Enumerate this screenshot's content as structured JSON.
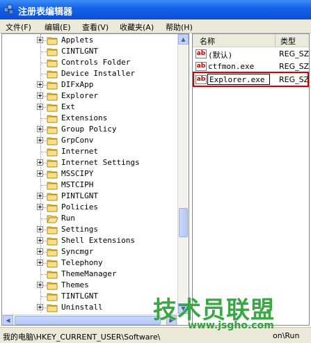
{
  "window": {
    "title": "注册表编辑器"
  },
  "menu": [
    {
      "label": "文件(F)"
    },
    {
      "label": "编辑(E)"
    },
    {
      "label": "查看(V)"
    },
    {
      "label": "收藏夹(A)"
    },
    {
      "label": "帮助(H)"
    }
  ],
  "tree": {
    "items": [
      {
        "label": "Applets",
        "expandable": true
      },
      {
        "label": "CINTLGNT",
        "expandable": false
      },
      {
        "label": "Controls Folder",
        "expandable": false
      },
      {
        "label": "Device Installer",
        "expandable": false
      },
      {
        "label": "DIFxApp",
        "expandable": true
      },
      {
        "label": "Explorer",
        "expandable": true
      },
      {
        "label": "Ext",
        "expandable": true
      },
      {
        "label": "Extensions",
        "expandable": false
      },
      {
        "label": "Group Policy",
        "expandable": true
      },
      {
        "label": "GrpConv",
        "expandable": true
      },
      {
        "label": "Internet",
        "expandable": false
      },
      {
        "label": "Internet Settings",
        "expandable": true
      },
      {
        "label": "MSSCIPY",
        "expandable": true
      },
      {
        "label": "MSTCIPH",
        "expandable": false
      },
      {
        "label": "PINTLGNT",
        "expandable": true
      },
      {
        "label": "Policies",
        "expandable": true
      },
      {
        "label": "Run",
        "expandable": false,
        "open": true
      },
      {
        "label": "Settings",
        "expandable": true
      },
      {
        "label": "Shell Extensions",
        "expandable": true
      },
      {
        "label": "Syncmgr",
        "expandable": true
      },
      {
        "label": "Telephony",
        "expandable": true
      },
      {
        "label": "ThemeManager",
        "expandable": false
      },
      {
        "label": "Themes",
        "expandable": true
      },
      {
        "label": "TINTLGNT",
        "expandable": false
      },
      {
        "label": "Uninstall",
        "expandable": true
      }
    ]
  },
  "list": {
    "headers": {
      "name": "名称",
      "type": "类型"
    },
    "rows": [
      {
        "name": "(默认)",
        "type": "REG_SZ"
      },
      {
        "name": "ctfmon.exe",
        "type": "REG_SZ"
      },
      {
        "name": "Explorer.exe",
        "type": "REG_SZ",
        "editing": true
      }
    ]
  },
  "status": {
    "path": "我的电脑\\HKEY_CURRENT_USER\\Software\\",
    "path_tail": "on\\Run"
  },
  "watermark": {
    "text": "技术员联盟",
    "url": "www.jsgho.com"
  },
  "colors": {
    "titlebar": "#0a4fd8",
    "highlight": "#d40000",
    "watermark": "#2fa33a"
  },
  "icons": {
    "app": "registry-icon",
    "folder": "folder-icon",
    "value": "string-value-icon"
  }
}
